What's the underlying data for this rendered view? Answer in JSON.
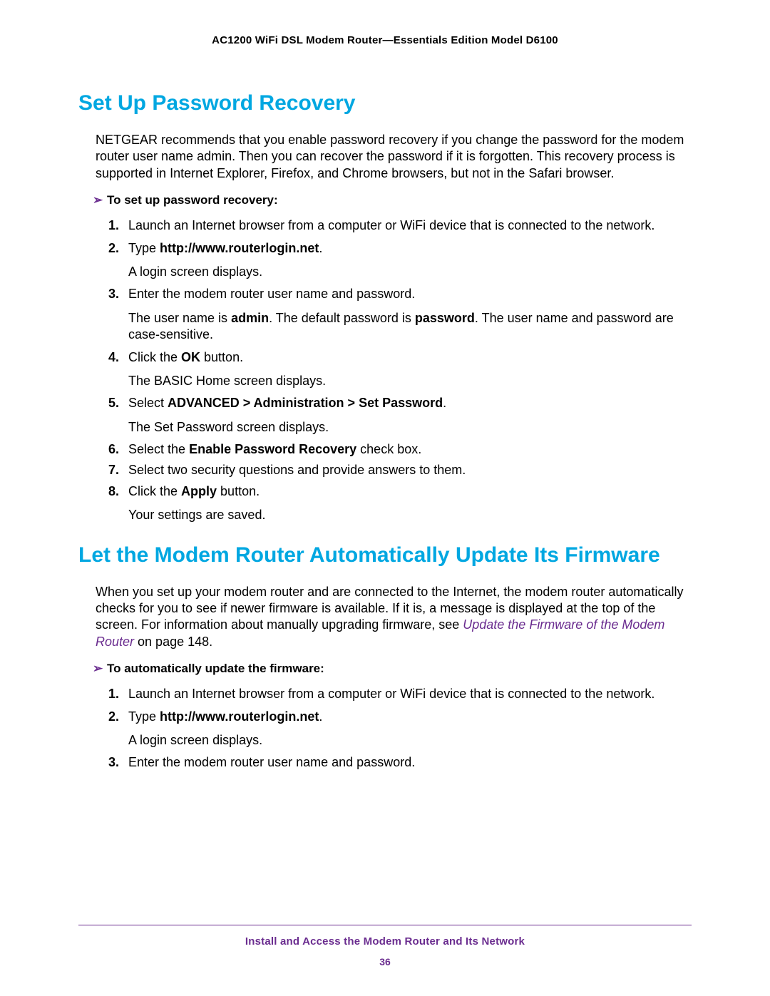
{
  "header": {
    "product_line": "AC1200 WiFi DSL Modem Router—Essentials Edition Model D6100"
  },
  "section1": {
    "heading": "Set Up Password Recovery",
    "intro": "NETGEAR recommends that you enable password recovery if you change the password for the modem router user name admin. Then you can recover the password if it is forgotten. This recovery process is supported in Internet Explorer, Firefox, and Chrome browsers, but not in the Safari browser.",
    "task_heading": "To set up password recovery:",
    "steps": {
      "s1": "Launch an Internet browser from a computer or WiFi device that is connected to the network.",
      "s2_pre": "Type ",
      "s2_url": "http://www.routerlogin.net",
      "s2_post": ".",
      "s2_sub": "A login screen displays.",
      "s3": "Enter the modem router user name and password.",
      "s3_sub_a": "The user name is ",
      "s3_admin": "admin",
      "s3_sub_b": ". The default password is ",
      "s3_password": "password",
      "s3_sub_c": ". The user name and password are case-sensitive.",
      "s4_pre": "Click the ",
      "s4_btn": "OK",
      "s4_post": " button.",
      "s4_sub": "The BASIC Home screen displays.",
      "s5_pre": "Select ",
      "s5_path": "ADVANCED > Administration > Set Password",
      "s5_post": ".",
      "s5_sub": "The Set Password screen displays.",
      "s6_pre": "Select the ",
      "s6_chk": "Enable Password Recovery",
      "s6_post": " check box.",
      "s7": "Select two security questions and provide answers to them.",
      "s8_pre": "Click the ",
      "s8_btn": "Apply",
      "s8_post": " button.",
      "s8_sub": "Your settings are saved."
    }
  },
  "section2": {
    "heading": "Let the Modem Router Automatically Update Its Firmware",
    "intro_a": "When you set up your modem router and are connected to the Internet, the modem router automatically checks for you to see if newer firmware is available. If it is, a message is displayed at the top of the screen. For information about manually upgrading firmware, see ",
    "xref": "Update the Firmware of the Modem Router",
    "intro_b": " on page 148.",
    "task_heading": "To automatically update the firmware:",
    "steps": {
      "s1": "Launch an Internet browser from a computer or WiFi device that is connected to the network.",
      "s2_pre": "Type ",
      "s2_url": "http://www.routerlogin.net",
      "s2_post": ".",
      "s2_sub": "A login screen displays.",
      "s3": "Enter the modem router user name and password."
    }
  },
  "footer": {
    "chapter": "Install and Access the Modem Router and Its Network",
    "page": "36"
  },
  "glyphs": {
    "chevron": "➢"
  }
}
